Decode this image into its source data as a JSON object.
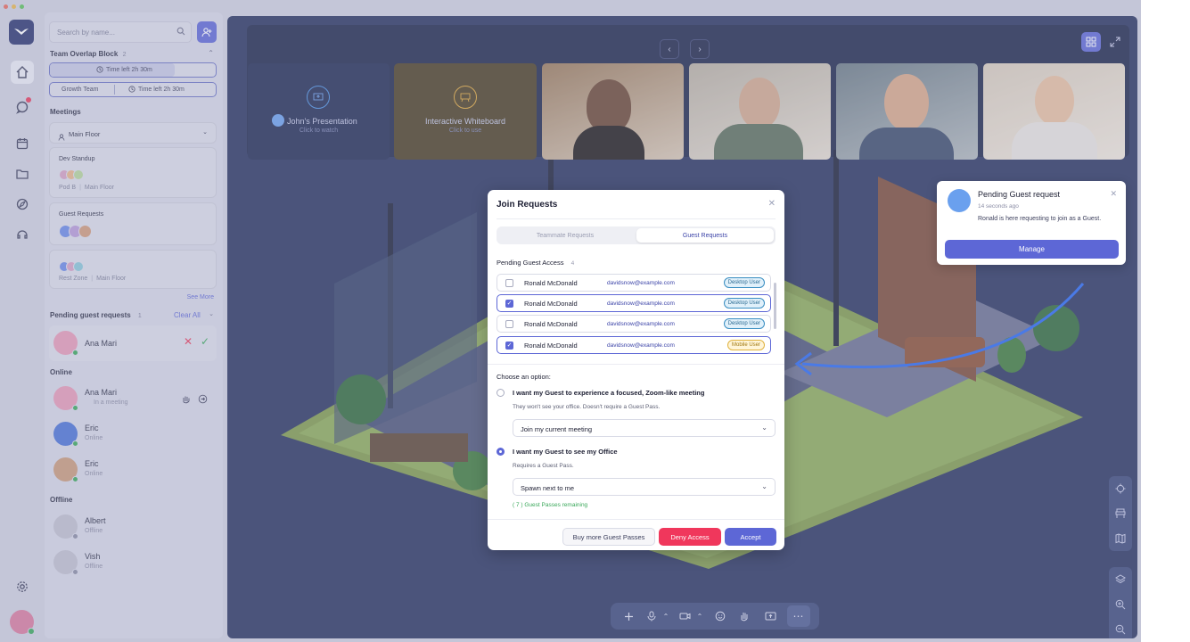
{
  "search": {
    "placeholder": "Search by name..."
  },
  "team_overlap": {
    "title": "Team Overlap Block",
    "count": "2",
    "pills": [
      {
        "team": "",
        "time": "Time left 2h 30m"
      },
      {
        "team": "Growth Team",
        "time": "Time left 2h 30m"
      }
    ]
  },
  "meetings": {
    "title": "Meetings",
    "floor_select": "Main Floor",
    "rooms": [
      {
        "name": "Dev Standup",
        "room": "Pod B",
        "floor": "Main Floor"
      },
      {
        "name": "Guest Requests"
      },
      {
        "name": "",
        "room": "Rest Zone",
        "floor": "Main Floor"
      }
    ],
    "see_more": "See More"
  },
  "pending": {
    "title": "Pending guest requests",
    "count": "1",
    "clear_all": "Clear All",
    "person": "Ana Mari"
  },
  "online": {
    "title": "Online",
    "people": [
      {
        "name": "Ana Mari",
        "status": "In a meeting"
      },
      {
        "name": "Eric",
        "status": "Online"
      },
      {
        "name": "Eric",
        "status": "Online"
      }
    ]
  },
  "offline": {
    "title": "Offline",
    "people": [
      {
        "name": "Albert",
        "status": "Offline"
      },
      {
        "name": "Vish",
        "status": "Offline"
      }
    ]
  },
  "tiles": {
    "presentation": {
      "title": "John's Presentation",
      "sub": "Click to watch"
    },
    "whiteboard": {
      "title": "Interactive Whiteboard",
      "sub": "Click to use"
    }
  },
  "modal": {
    "title": "Join Requests",
    "tabs": [
      "Teammate Requests",
      "Guest Requests"
    ],
    "pending_title": "Pending Guest Access",
    "pending_count": "4",
    "rows": [
      {
        "name": "Ronald McDonald",
        "email": "davidsnow@example.com",
        "badge": "Desktop User",
        "checked": false
      },
      {
        "name": "Ronald McDonald",
        "email": "davidsnow@example.com",
        "badge": "Desktop User",
        "checked": true
      },
      {
        "name": "Ronald McDonald",
        "email": "davidsnow@example.com",
        "badge": "Desktop User",
        "checked": false
      },
      {
        "name": "Ronald McDonald",
        "email": "davidsnow@example.com",
        "badge": "Mobile User",
        "checked": true
      }
    ],
    "choose": "Choose an option:",
    "option1": {
      "title": "I want my Guest to experience a focused, Zoom-like meeting",
      "desc": "They won't see your office. Doesn't require a Guest Pass.",
      "select": "Join my current meeting"
    },
    "option2": {
      "title": "I want my Guest to see my Office",
      "desc": "Requires a Guest Pass.",
      "select": "Spawn next to me"
    },
    "passes": "( 7 ) Guest Passes remaining",
    "buttons": {
      "buy": "Buy more Guest Passes",
      "deny": "Deny Access",
      "accept": "Accept"
    }
  },
  "notification": {
    "title": "Pending Guest request",
    "time": "14 seconds ago",
    "message": "Ronald is here requesting to join as a Guest.",
    "action": "Manage"
  },
  "colors": {
    "accent": "#5d67d6",
    "deny": "#f0375c",
    "online": "#3aa85a",
    "stage": "#27335f"
  }
}
